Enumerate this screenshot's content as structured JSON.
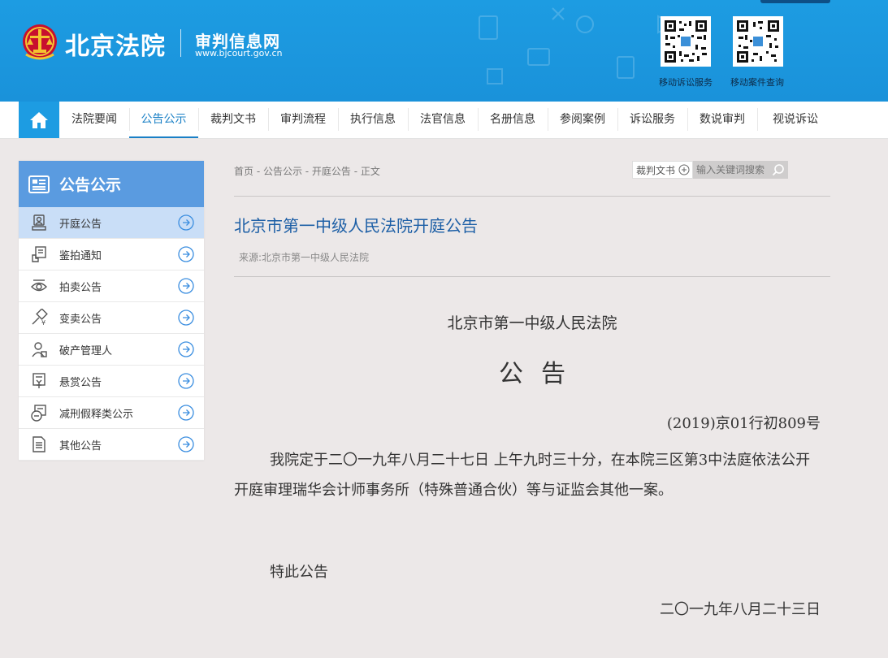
{
  "header": {
    "logo_text": "北京法院",
    "site_name": "审判信息网",
    "site_url": "www.bjcourt.gov.cn",
    "qr_codes": [
      {
        "label": "移动诉讼服务",
        "icon": "qr-code-icon"
      },
      {
        "label": "移动案件查询",
        "icon": "qr-code-icon"
      }
    ]
  },
  "nav": {
    "home_icon": "home-icon",
    "items": [
      {
        "label": "法院要闻"
      },
      {
        "label": "公告公示",
        "active": true
      },
      {
        "label": "裁判文书"
      },
      {
        "label": "审判流程"
      },
      {
        "label": "执行信息"
      },
      {
        "label": "法官信息"
      },
      {
        "label": "名册信息"
      },
      {
        "label": "参阅案例"
      },
      {
        "label": "诉讼服务"
      },
      {
        "label": "数说审判"
      },
      {
        "label": "视说诉讼"
      }
    ]
  },
  "sidebar": {
    "title": "公告公示",
    "title_icon": "notice-board-icon",
    "items": [
      {
        "label": "开庭公告",
        "icon": "court-icon",
        "active": true
      },
      {
        "label": "鉴拍通知",
        "icon": "stamp-icon"
      },
      {
        "label": "拍卖公告",
        "icon": "eye-icon"
      },
      {
        "label": "变卖公告",
        "icon": "gavel-icon"
      },
      {
        "label": "破产管理人",
        "icon": "person-icon"
      },
      {
        "label": "悬赏公告",
        "icon": "yen-icon"
      },
      {
        "label": "减刑假释类公示",
        "icon": "minus-circle-icon"
      },
      {
        "label": "其他公告",
        "icon": "document-icon"
      }
    ]
  },
  "main": {
    "breadcrumb": "首页 - 公告公示 - 开庭公告 - 正文",
    "search_scope": "裁判文书",
    "search_placeholder": "输入关键词搜索",
    "title": "北京市第一中级人民法院开庭公告",
    "source": "来源:北京市第一中级人民法院",
    "document": {
      "court_name": "北京市第一中级人民法院",
      "notice_title": "公告",
      "case_number": "(2019)京01行初809号",
      "body": "我院定于二〇一九年八月二十七日 上午九时三十分，在本院三区第3中法庭依法公开开庭审理瑞华会计师事务所（特殊普通合伙）等与证监会其他一案。",
      "closing": "特此公告",
      "date": "二〇一九年八月二十三日"
    }
  },
  "colors": {
    "header_blue": "#1d9ce2",
    "sidebar_head": "#5a9be0",
    "sidebar_active": "#c9def7",
    "title_blue": "#1d5fa6",
    "nav_active": "#1a80c6"
  }
}
